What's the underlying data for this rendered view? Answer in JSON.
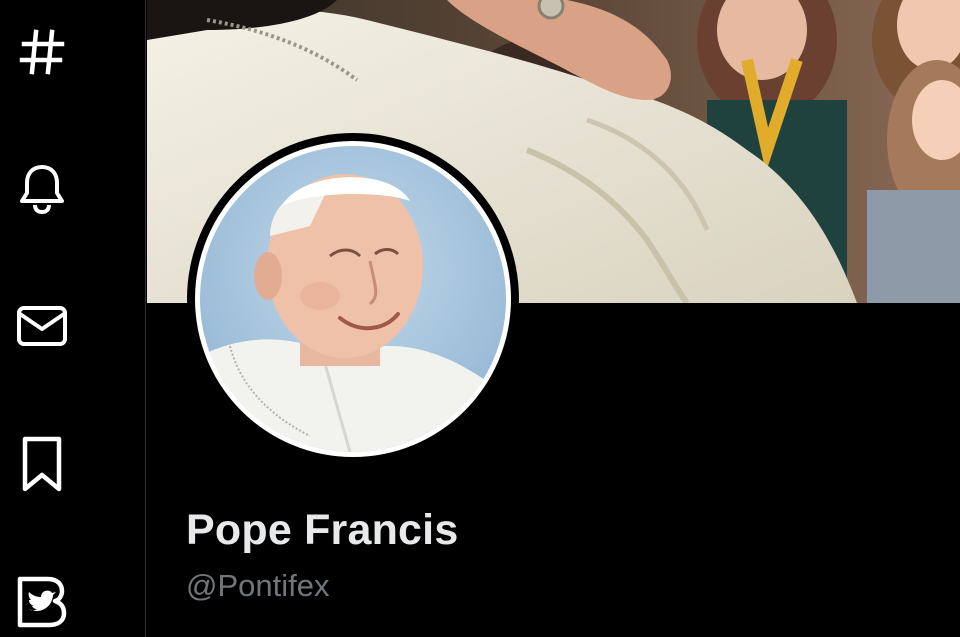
{
  "nav": {
    "items": [
      {
        "icon": "hashtag-icon",
        "label": "Explore"
      },
      {
        "icon": "bell-icon",
        "label": "Notifications"
      },
      {
        "icon": "envelope-icon",
        "label": "Messages"
      },
      {
        "icon": "bookmark-icon",
        "label": "Bookmarks"
      },
      {
        "icon": "twitter-blue-icon",
        "label": "Twitter Blue"
      }
    ]
  },
  "profile": {
    "display_name": "Pope Francis",
    "handle": "@Pontifex"
  },
  "colors": {
    "background": "#000000",
    "text_primary": "#e7e9ea",
    "text_secondary": "#71767b",
    "divider": "#2f3336"
  }
}
